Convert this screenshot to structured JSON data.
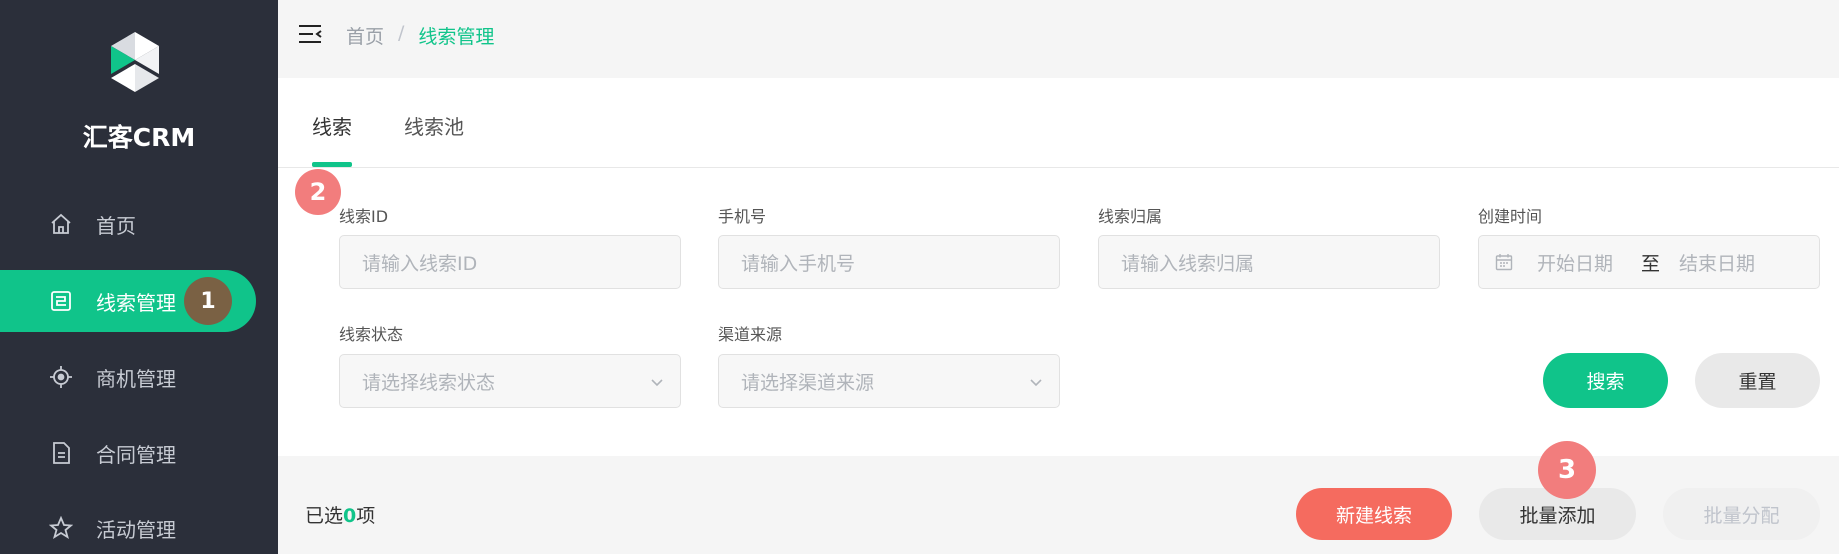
{
  "app": {
    "name": "汇客CRM"
  },
  "sidebar": {
    "items": [
      {
        "label": "首页",
        "icon": "home-icon",
        "active": false
      },
      {
        "label": "线索管理",
        "icon": "clue-icon",
        "active": true
      },
      {
        "label": "商机管理",
        "icon": "target-icon",
        "active": false
      },
      {
        "label": "合同管理",
        "icon": "document-icon",
        "active": false
      },
      {
        "label": "活动管理",
        "icon": "star-icon",
        "active": false
      }
    ]
  },
  "header": {
    "breadcrumb": {
      "home": "首页",
      "separator": "/",
      "current": "线索管理"
    }
  },
  "tabs": [
    {
      "label": "线索",
      "active": true
    },
    {
      "label": "线索池",
      "active": false
    }
  ],
  "filters": {
    "lead_id": {
      "label": "线索ID",
      "placeholder": "请输入线索ID"
    },
    "phone": {
      "label": "手机号",
      "placeholder": "请输入手机号"
    },
    "owner": {
      "label": "线索归属",
      "placeholder": "请输入线索归属"
    },
    "created_time": {
      "label": "创建时间",
      "start_placeholder": "开始日期",
      "separator": "至",
      "end_placeholder": "结束日期"
    },
    "status": {
      "label": "线索状态",
      "placeholder": "请选择线索状态"
    },
    "channel": {
      "label": "渠道来源",
      "placeholder": "请选择渠道来源"
    }
  },
  "actions": {
    "search": "搜索",
    "reset": "重置",
    "new_lead": "新建线索",
    "batch_add": "批量添加",
    "batch_assign": "批量分配"
  },
  "selection": {
    "prefix": "已选",
    "count": "0",
    "suffix": "项"
  },
  "step_markers": [
    "1",
    "2",
    "3"
  ],
  "colors": {
    "accent": "#10c48a",
    "sidebar_bg": "#2b2f3a",
    "danger": "#f56b5f",
    "marker": "#f27d7d"
  }
}
